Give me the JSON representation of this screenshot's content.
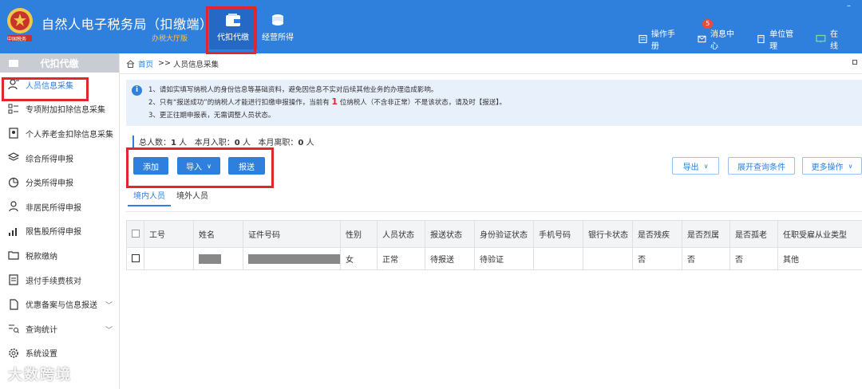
{
  "header": {
    "title": "自然人电子税务局（扣缴端）",
    "subtitle": "办税大厅版",
    "logo_text": "中国税务",
    "tabs": [
      {
        "label": "代扣代缴",
        "icon": "wallet-icon",
        "active": true
      },
      {
        "label": "经营所得",
        "icon": "coins-icon",
        "active": false
      }
    ],
    "links": [
      {
        "label": "操作手册",
        "icon": "manual-icon"
      },
      {
        "label": "消息中心",
        "icon": "message-icon",
        "badge": "5"
      },
      {
        "label": "单位管理",
        "icon": "building-icon"
      },
      {
        "label": "在线",
        "icon": "monitor-icon"
      }
    ],
    "window_control": "–"
  },
  "sidebar": {
    "title": "代扣代缴",
    "items": [
      {
        "label": "人员信息采集",
        "icon": "person-add-icon",
        "active": true
      },
      {
        "label": "专项附加扣除信息采集",
        "icon": "list-icon"
      },
      {
        "label": "个人养老金扣除信息采集",
        "icon": "document-person-icon"
      },
      {
        "label": "综合所得申报",
        "icon": "layers-icon"
      },
      {
        "label": "分类所得申报",
        "icon": "pie-chart-icon"
      },
      {
        "label": "非居民所得申报",
        "icon": "person-icon"
      },
      {
        "label": "限售股所得申报",
        "icon": "bar-chart-icon"
      },
      {
        "label": "税款缴纳",
        "icon": "folder-icon"
      },
      {
        "label": "退付手续费核对",
        "icon": "checklist-icon"
      },
      {
        "label": "优惠备案与信息报送",
        "icon": "file-icon",
        "caret": "﹀"
      },
      {
        "label": "查询统计",
        "icon": "query-icon",
        "caret": "﹀"
      },
      {
        "label": "系统设置",
        "icon": "gear-icon"
      }
    ]
  },
  "breadcrumb": {
    "home": "首页",
    "separator": ">>",
    "current": "人员信息采集"
  },
  "notice": {
    "line1": "1、请如实填写纳税人的身份信息等基础资料，避免因信息不实对后续其他业务的办理造成影响。",
    "line2_pre": "2、只有“报送成功”的纳税人才能进行扣缴申报操作，当前有",
    "line2_count": "1",
    "line2_post": "位纳税人（不含非正常）不是该状态，请及时【报送】。",
    "line3": "3、更正往期申报表，无需调整人员状态。"
  },
  "stats": {
    "total_label": "总人数：",
    "total": "1",
    "unit1": "人",
    "join_label": "本月入职：",
    "join": "0",
    "unit2": "人",
    "leave_label": "本月离职：",
    "leave": "0",
    "unit3": "人"
  },
  "buttons": {
    "add": "添加",
    "import": "导入",
    "submit": "报送",
    "export": "导出",
    "expand_query": "展开查询条件",
    "more": "更多操作"
  },
  "sub_tabs": [
    "境内人员",
    "境外人员"
  ],
  "table": {
    "columns": [
      "工号",
      "姓名",
      "证件号码",
      "性别",
      "人员状态",
      "报送状态",
      "身份验证状态",
      "手机号码",
      "银行卡状态",
      "是否残疾",
      "是否烈属",
      "是否孤老",
      "任职受雇从业类型"
    ],
    "rows": [
      {
        "gonghao": "",
        "name": "",
        "id_no": "",
        "gender": "女",
        "status": "正常",
        "submit_status": "待报送",
        "verify_status": "待验证",
        "phone": "",
        "bank_status": "",
        "disabled": "否",
        "martyr": "否",
        "elderly": "否",
        "job_type": "其他"
      }
    ]
  },
  "watermark": "大数跨境",
  "colors": {
    "header_blue": "#2f7fdc",
    "highlight_red": "#e3262b",
    "notice_bg": "#e8f1fb"
  }
}
